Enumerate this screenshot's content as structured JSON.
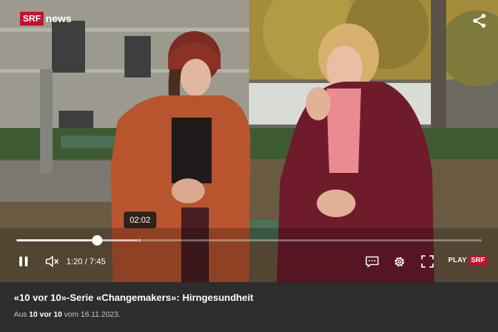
{
  "logo": {
    "brand": "SRF",
    "product": "news"
  },
  "player": {
    "hover_time": "02:02",
    "current_time": "1:20",
    "time_separator": "/",
    "duration": "7:45",
    "progress_fraction": 0.172,
    "buffered_fraction": 0.26,
    "hover_fraction": 0.263,
    "icons": {
      "share": "share-icon",
      "pause": "pause-icon",
      "volume": "volume-icon",
      "subtitles": "subtitles-icon",
      "settings": "gear-icon",
      "fullscreen": "fullscreen-icon"
    },
    "play_srf": {
      "play": "PLAY",
      "srf": "SRF"
    }
  },
  "video": {
    "title": "«10 vor 10»-Serie «Changemakers»: Hirngesundheit",
    "meta_prefix": "Aus",
    "meta_show": "10 vor 10",
    "meta_mid": "vom",
    "meta_date": "16.11.2023."
  },
  "colors": {
    "accent_red": "#c8102e",
    "info_bg": "#2d2d2d"
  }
}
